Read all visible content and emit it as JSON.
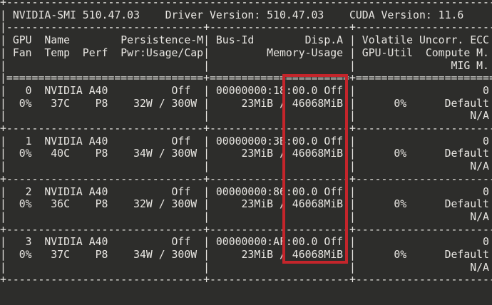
{
  "terminal": {
    "colors": {
      "background": "#2d2d2b",
      "text": "#e8e6e2",
      "highlight_box": "#c4252b"
    },
    "header": {
      "smi_version": "NVIDIA-SMI 510.47.03",
      "driver_version_label": "Driver Version:",
      "driver_version": "510.47.03",
      "cuda_version_label": "CUDA Version:",
      "cuda_version": "11.6"
    },
    "column_headers": {
      "row1": [
        "GPU",
        "Name",
        "Persistence-M",
        "Bus-Id",
        "Disp.A",
        "Volatile Uncorr. ECC"
      ],
      "row2": [
        "Fan",
        "Temp",
        "Perf",
        "Pwr:Usage/Cap",
        "Memory-Usage",
        "GPU-Util",
        "Compute M."
      ],
      "row3": [
        "MIG M."
      ]
    },
    "gpus": [
      {
        "index": "0",
        "name": "NVIDIA A40",
        "persistence": "Off",
        "fan": "0%",
        "temp": "37C",
        "perf": "P8",
        "power_usage": "32W",
        "power_cap": "300W",
        "bus_id": "00000000:18:00.0",
        "disp_a": "Off",
        "memory_used": "23MiB",
        "memory_total": "46068MiB",
        "gpu_util": "0%",
        "volatile_ecc": "0",
        "compute_mode": "Default",
        "mig_mode": "N/A"
      },
      {
        "index": "1",
        "name": "NVIDIA A40",
        "persistence": "Off",
        "fan": "0%",
        "temp": "40C",
        "perf": "P8",
        "power_usage": "34W",
        "power_cap": "300W",
        "bus_id": "00000000:3B:00.0",
        "disp_a": "Off",
        "memory_used": "23MiB",
        "memory_total": "46068MiB",
        "gpu_util": "0%",
        "volatile_ecc": "0",
        "compute_mode": "Default",
        "mig_mode": "N/A"
      },
      {
        "index": "2",
        "name": "NVIDIA A40",
        "persistence": "Off",
        "fan": "0%",
        "temp": "36C",
        "perf": "P8",
        "power_usage": "32W",
        "power_cap": "300W",
        "bus_id": "00000000:86:00.0",
        "disp_a": "Off",
        "memory_used": "23MiB",
        "memory_total": "46068MiB",
        "gpu_util": "0%",
        "volatile_ecc": "0",
        "compute_mode": "Default",
        "mig_mode": "N/A"
      },
      {
        "index": "3",
        "name": "NVIDIA A40",
        "persistence": "Off",
        "fan": "0%",
        "temp": "37C",
        "perf": "P8",
        "power_usage": "34W",
        "power_cap": "300W",
        "bus_id": "00000000:AF:00.0",
        "disp_a": "Off",
        "memory_used": "23MiB",
        "memory_total": "46068MiB",
        "gpu_util": "0%",
        "volatile_ecc": "0",
        "compute_mode": "Default",
        "mig_mode": "N/A"
      }
    ],
    "annotation_box": {
      "color": "#c4252b",
      "highlighted_values": [
        ":00.0 Off",
        "46068MiB"
      ]
    },
    "screen_lines": [
      "+-----------------------------------------------------------------------------+",
      "| NVIDIA-SMI 510.47.03    Driver Version: 510.47.03    CUDA Version: 11.6     |",
      "|-------------------------------+----------------------+----------------------+",
      "| GPU  Name        Persistence-M| Bus-Id        Disp.A | Volatile Uncorr. ECC |",
      "| Fan  Temp  Perf  Pwr:Usage/Cap|         Memory-Usage | GPU-Util  Compute M. |",
      "|                               |                      |               MIG M. |",
      "|===============================+======================+======================|",
      "|   0  NVIDIA A40          Off  | 00000000:18:00.0 Off |                    0 |",
      "|  0%   37C    P8    32W / 300W |     23MiB / 46068MiB |      0%      Default |",
      "|                               |                      |                  N/A |",
      "+-------------------------------+----------------------+----------------------+",
      "|   1  NVIDIA A40          Off  | 00000000:3B:00.0 Off |                    0 |",
      "|  0%   40C    P8    34W / 300W |     23MiB / 46068MiB |      0%      Default |",
      "|                               |                      |                  N/A |",
      "+-------------------------------+----------------------+----------------------+",
      "|   2  NVIDIA A40          Off  | 00000000:86:00.0 Off |                    0 |",
      "|  0%   36C    P8    32W / 300W |     23MiB / 46068MiB |      0%      Default |",
      "|                               |                      |                  N/A |",
      "+-------------------------------+----------------------+----------------------+",
      "|   3  NVIDIA A40          Off  | 00000000:AF:00.0 Off |                    0 |",
      "|  0%   37C    P8    34W / 300W |     23MiB / 46068MiB |      0%      Default |",
      "|                               |                      |                  N/A |",
      "+-------------------------------+----------------------+----------------------+"
    ]
  }
}
